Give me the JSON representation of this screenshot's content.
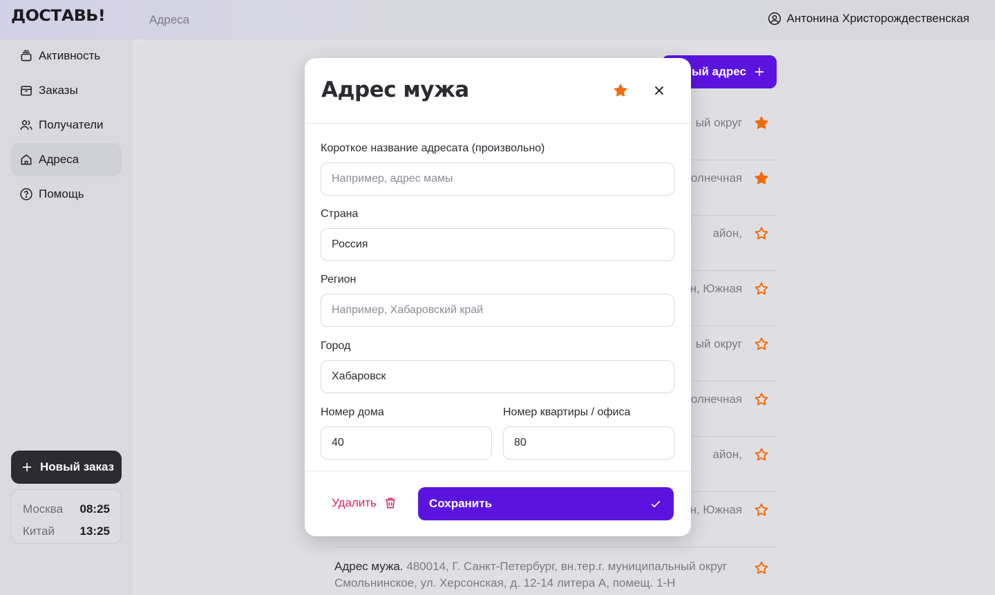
{
  "app": {
    "logo": "ДОСТАВЬ!",
    "breadcrumb": "Адреса",
    "user_name": "Антонина Христорождественская"
  },
  "sidebar": {
    "items": [
      {
        "label": "Активность",
        "icon": "activity-icon"
      },
      {
        "label": "Заказы",
        "icon": "box-icon"
      },
      {
        "label": "Получатели",
        "icon": "users-icon"
      },
      {
        "label": "Адреса",
        "icon": "home-icon",
        "active": true
      },
      {
        "label": "Помощь",
        "icon": "help-icon"
      }
    ],
    "new_order_label": "Новый заказ",
    "clocks": [
      {
        "city": "Москва",
        "time": "08:25"
      },
      {
        "city": "Китай",
        "time": "13:25"
      }
    ]
  },
  "main": {
    "new_address_label": "ый адрес",
    "rows": [
      {
        "text": "ый округ",
        "favorite": true
      },
      {
        "text": "олнечная",
        "favorite": true
      },
      {
        "text": "айон,",
        "favorite": false
      },
      {
        "text": "он, Южная",
        "favorite": false
      },
      {
        "text": "ый округ",
        "favorite": false
      },
      {
        "text": "олнечная",
        "favorite": false
      },
      {
        "text": "айон,",
        "favorite": false
      },
      {
        "text": "он, Южная",
        "favorite": false
      }
    ],
    "last_row": {
      "name": "Адрес мужа.",
      "line1": "480014, Г. Санкт-Петербург, вн.тер.г. муниципальный округ",
      "line2": "Смольнинское, ул. Херсонская, д. 12-14 литера А, помещ. 1-Н",
      "favorite": false
    }
  },
  "modal": {
    "title": "Адрес мужа",
    "favorite": true,
    "fields": {
      "short_name": {
        "label": "Короткое название адресата (произвольно)",
        "value": "",
        "placeholder": "Например, адрес мамы"
      },
      "country": {
        "label": "Страна",
        "value": "Россия",
        "placeholder": ""
      },
      "region": {
        "label": "Регион",
        "value": "",
        "placeholder": "Например, Хабаровский край"
      },
      "city": {
        "label": "Город",
        "value": "Хабаровск",
        "placeholder": ""
      },
      "house": {
        "label": "Номер дома",
        "value": "40",
        "placeholder": ""
      },
      "apartment": {
        "label": "Номер квартиры / офиса",
        "value": "80",
        "placeholder": ""
      }
    },
    "delete_label": "Удалить",
    "save_label": "Сохранить"
  },
  "colors": {
    "accent": "#5b14e0",
    "star": "#f26a0a",
    "danger": "#e0245e"
  }
}
